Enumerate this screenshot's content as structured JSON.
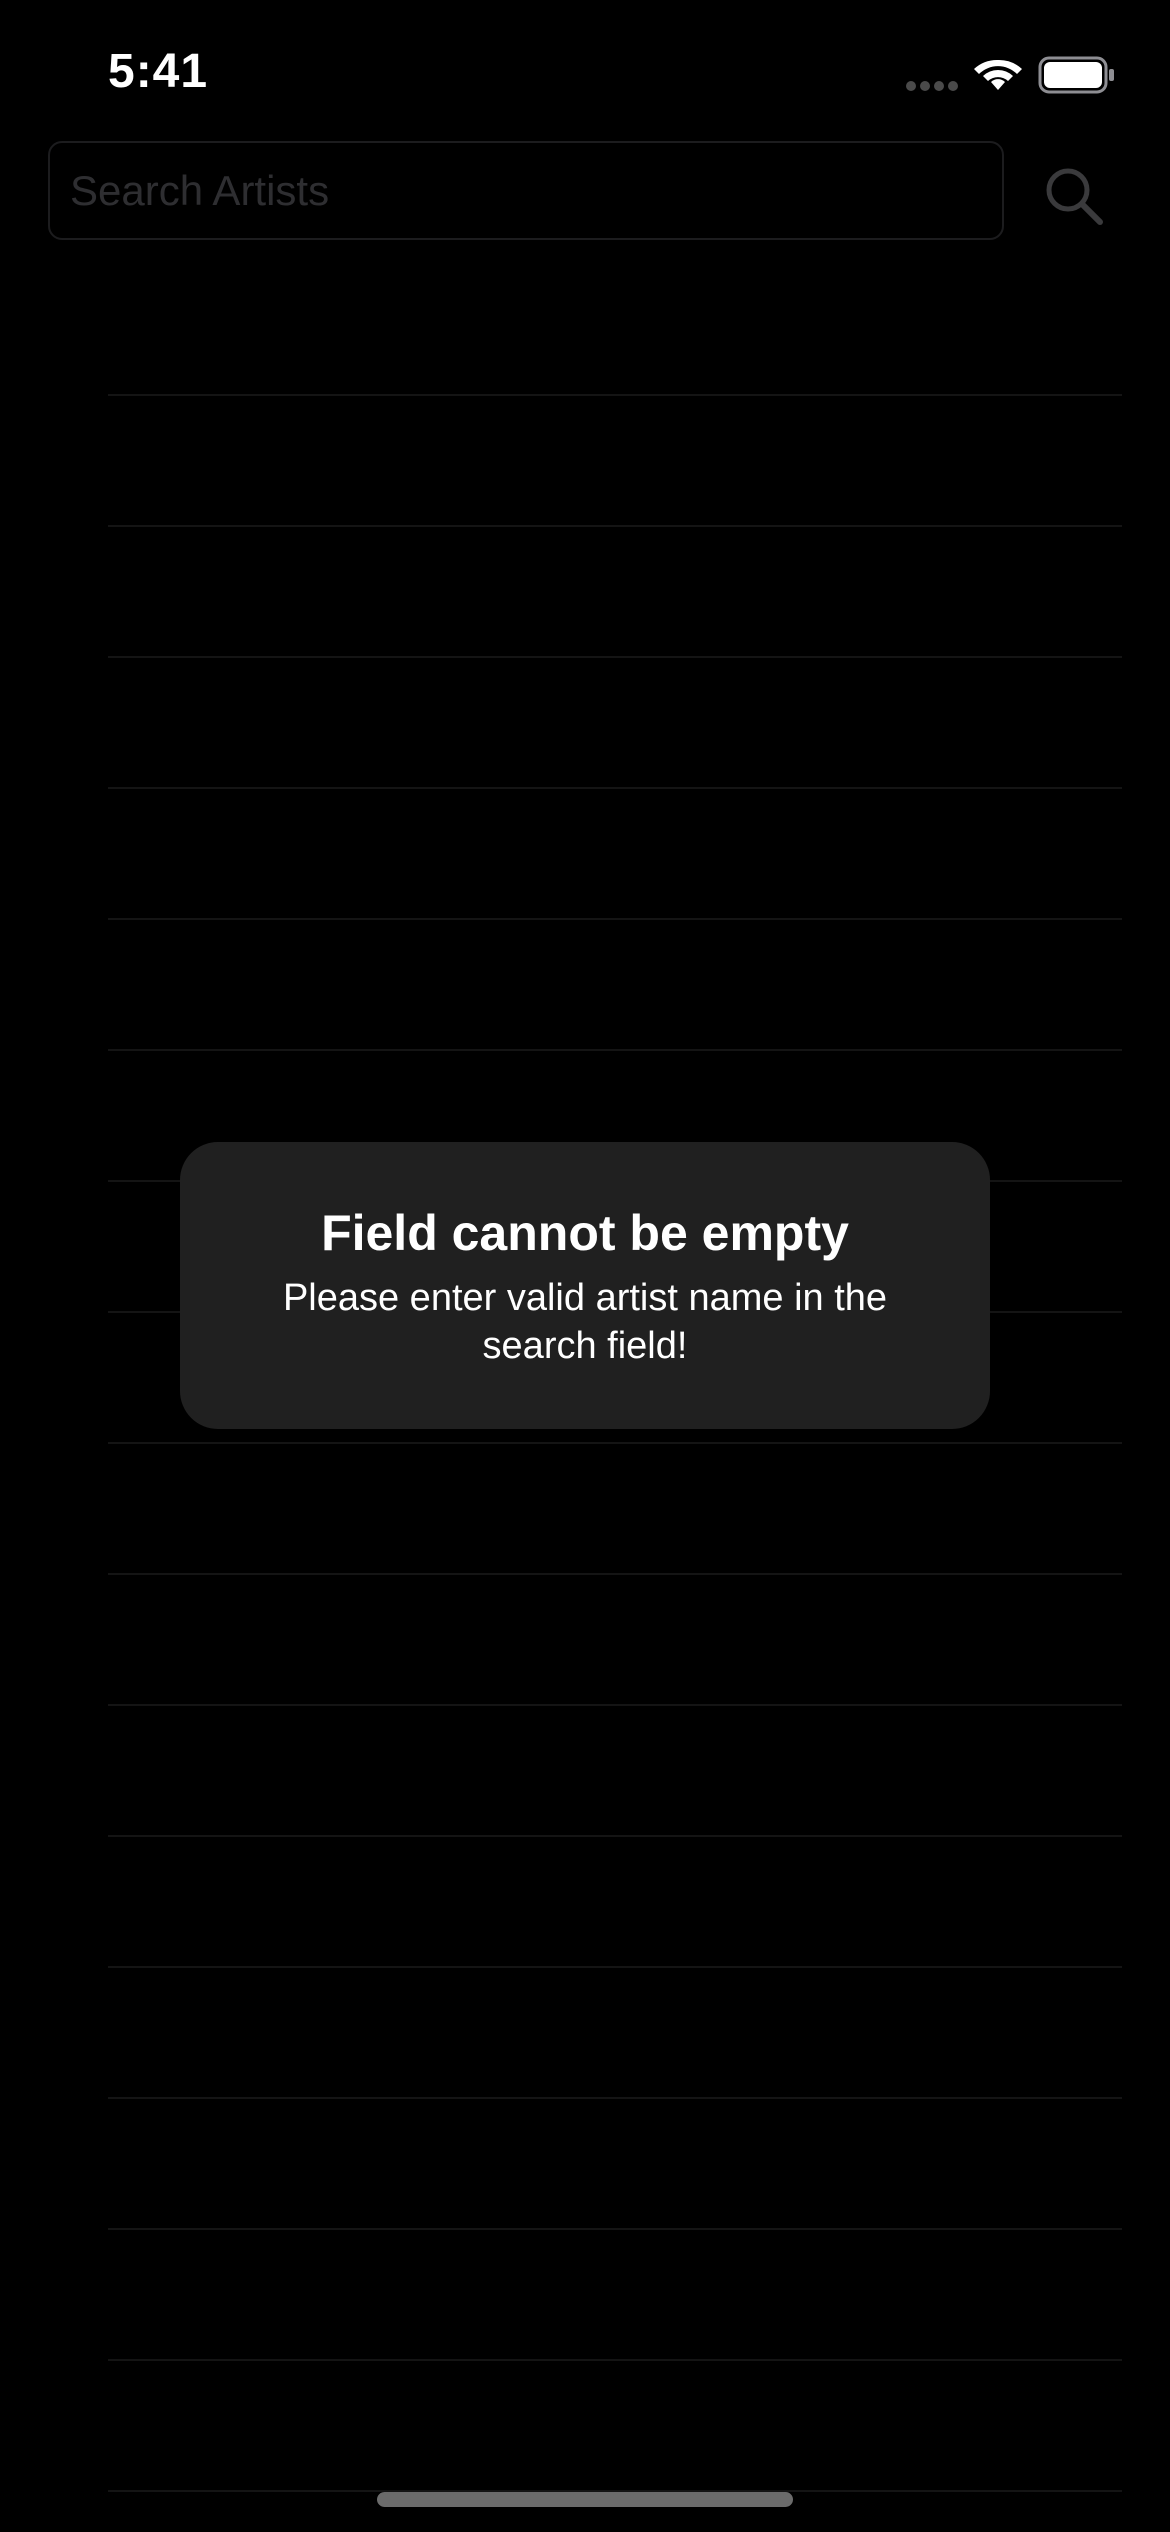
{
  "status_bar": {
    "time": "5:41"
  },
  "search": {
    "placeholder": "Search Artists",
    "value": "",
    "button_icon": "magnifying-glass-icon"
  },
  "results": {
    "rows": [
      "",
      "",
      "",
      "",
      "",
      "",
      "",
      "",
      "",
      "",
      "",
      "",
      "",
      "",
      "",
      "",
      ""
    ]
  },
  "alert": {
    "title": "Field cannot be empty",
    "message": "Please enter valid artist name in the search field!"
  },
  "colors": {
    "background": "#000000",
    "alert_background": "#202020",
    "separator": "#141414",
    "text": "#ffffff"
  }
}
